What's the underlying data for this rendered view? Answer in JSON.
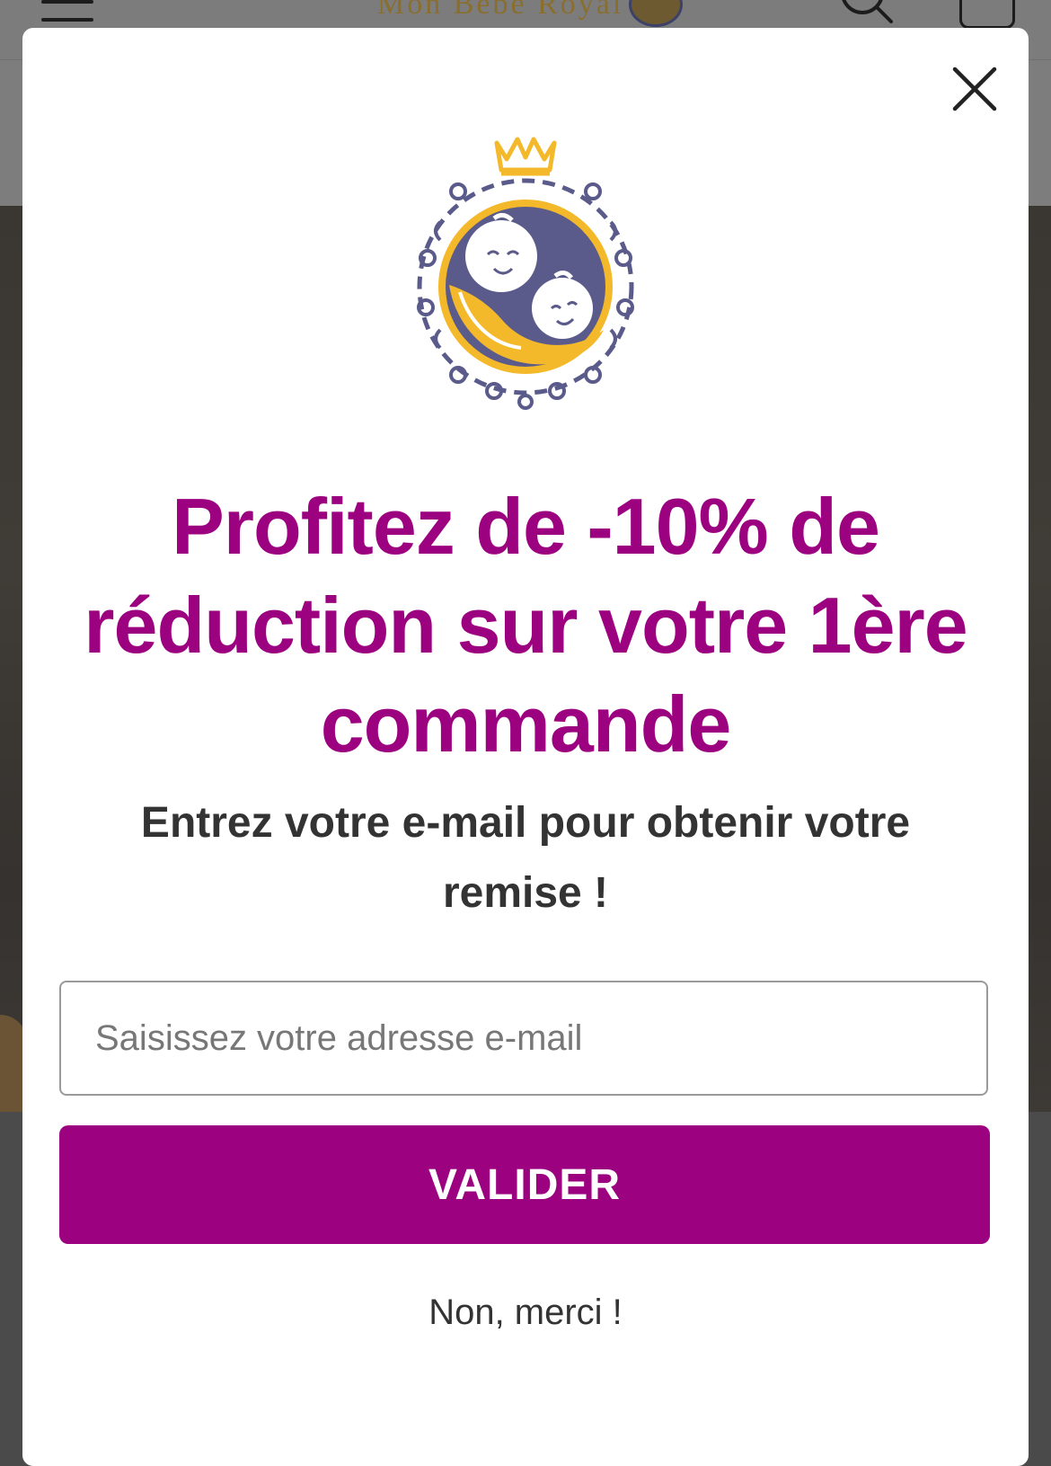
{
  "background_page": {
    "site_name": "Mon Bébé Royal",
    "icons": [
      "menu-icon",
      "search-icon",
      "bag-icon"
    ]
  },
  "popup": {
    "close_icon": "close-icon",
    "logo_icon": "royal-baby-crest-logo",
    "headline": "Profitez de -10% de réduction sur votre 1ère commande",
    "subheadline": "Entrez votre e-mail pour obtenir votre remise !",
    "email_placeholder": "Saisissez votre adresse e-mail",
    "email_value": "",
    "submit_label": "VALIDER",
    "decline_label": "Non, merci !"
  },
  "colors": {
    "accent": "#9c0280",
    "logo_navy": "#5a5b8a",
    "logo_gold": "#f3b92a",
    "overlay": "#4a4a4a"
  }
}
